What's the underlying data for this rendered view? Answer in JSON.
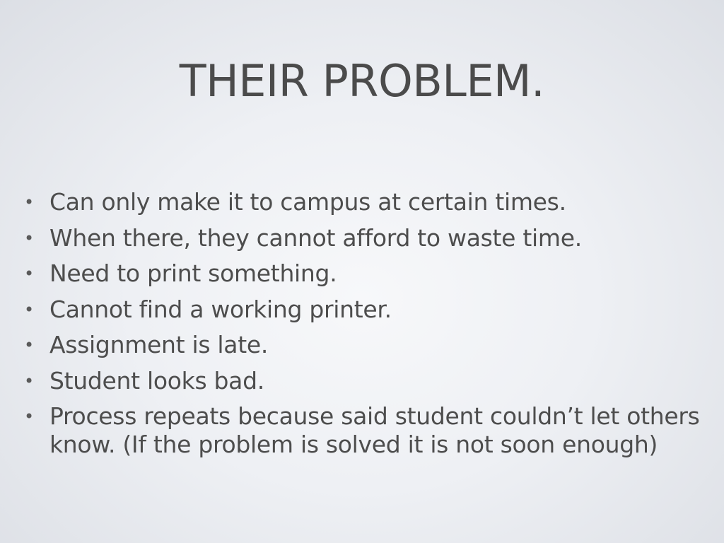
{
  "slide": {
    "title": "THEIR PROBLEM.",
    "bullet_symbol": "•",
    "bullets": [
      "Can only make it to campus at certain times.",
      "When there, they cannot afford to waste time.",
      "Need to print something.",
      "Cannot find a working printer.",
      "Assignment is late.",
      "Student looks bad.",
      "Process repeats because said student couldn’t let others know. (If the problem is solved it is not soon enough)"
    ]
  }
}
